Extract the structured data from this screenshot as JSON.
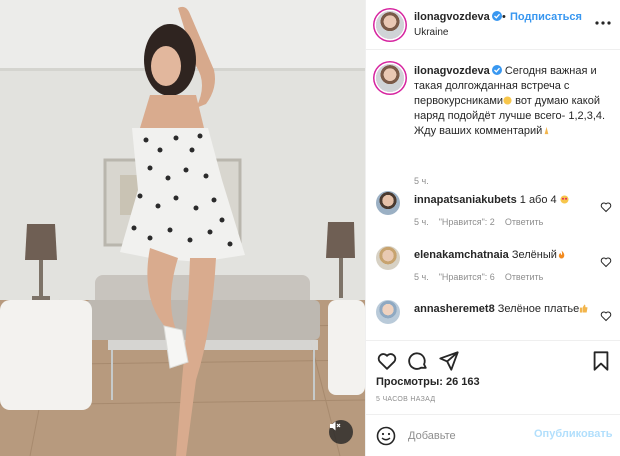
{
  "post": {
    "author": "ilonagvozdeva",
    "follow_label": "Подписаться",
    "location": "Ukraine",
    "caption_text": "Сегодня важная и такая долгожданная встреча с первокурсниками",
    "caption_text2": " вот думаю какой наряд подойдёт лучше всего- 1,2,3,4.\nЖду ваших комментарий",
    "caption_time": "5 ч."
  },
  "comments": [
    {
      "user": "innapatsaniakubets",
      "text": "1 або 4",
      "time": "5 ч.",
      "likes": "\"Нравится\": 2",
      "reply": "Ответить"
    },
    {
      "user": "elenakamchatnaia",
      "text": "Зелёный",
      "time": "5 ч.",
      "likes": "\"Нравится\": 6",
      "reply": "Ответить"
    },
    {
      "user": "annasheremet8",
      "text": "Зелёное платье",
      "time": "",
      "likes": "",
      "reply": ""
    }
  ],
  "stats": {
    "views_label": "Просмотры:",
    "views_count": "26 163",
    "posted": "5 часов назад"
  },
  "add_comment": {
    "placeholder": "Добавьте",
    "publish_label": "Опубликовать"
  },
  "colors": {
    "accent": "#3897f0",
    "verified": "#3897f0",
    "muted": "#8e8e8e",
    "publish_disabled": "#b2dffc"
  },
  "icons": {
    "more": "more-horizontal-icon",
    "like": "heart-icon",
    "comment": "comment-icon",
    "share": "paper-plane-icon",
    "save": "bookmark-icon",
    "emoji": "smiley-icon",
    "mute": "speaker-muted-icon"
  }
}
